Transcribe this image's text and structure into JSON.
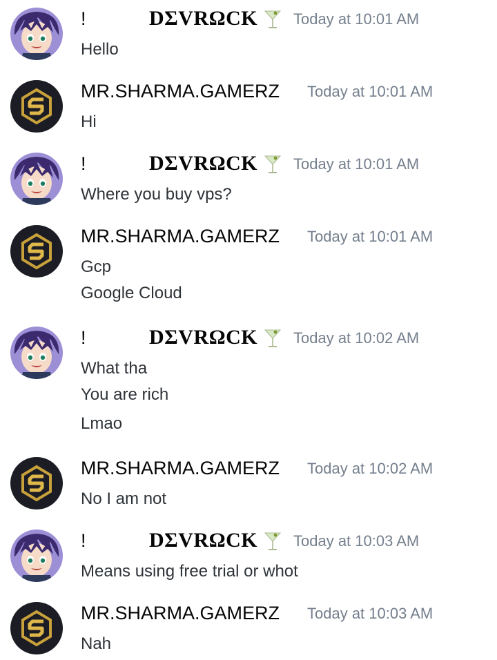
{
  "users": {
    "devrock": {
      "prefix": "!",
      "name": "DΣVRΩCK",
      "emoji_icon": "cocktail-glass-icon",
      "avatar_icon": "anime-boy-avatar"
    },
    "sharma": {
      "name": "MR.SHARMA.GAMERZ",
      "avatar_icon": "gold-s-logo-avatar"
    }
  },
  "messages": [
    {
      "author": "devrock",
      "timestamp": "Today at 10:01 AM",
      "lines": [
        "Hello"
      ]
    },
    {
      "author": "sharma",
      "timestamp": "Today at 10:01 AM",
      "lines": [
        "Hi"
      ]
    },
    {
      "author": "devrock",
      "timestamp": "Today at 10:01 AM",
      "lines": [
        "Where you buy vps?"
      ]
    },
    {
      "author": "sharma",
      "timestamp": "Today at 10:01 AM",
      "lines": [
        "Gcp",
        "Google Cloud"
      ]
    },
    {
      "author": "devrock",
      "timestamp": "Today at 10:02 AM",
      "lines": [
        "What tha",
        "You are rich",
        "Lmao"
      ]
    },
    {
      "author": "sharma",
      "timestamp": "Today at 10:02 AM",
      "lines": [
        "No I am not"
      ]
    },
    {
      "author": "devrock",
      "timestamp": "Today at 10:03 AM",
      "lines": [
        "Means using free trial or whot"
      ]
    },
    {
      "author": "sharma",
      "timestamp": "Today at 10:03 AM",
      "lines": [
        "Nah"
      ]
    }
  ],
  "colors": {
    "text": "#2e3338",
    "username": "#060607",
    "timestamp": "#747f8d",
    "background": "#ffffff",
    "logo_gold": "#c9a13b",
    "logo_bg": "#1c1d24"
  }
}
